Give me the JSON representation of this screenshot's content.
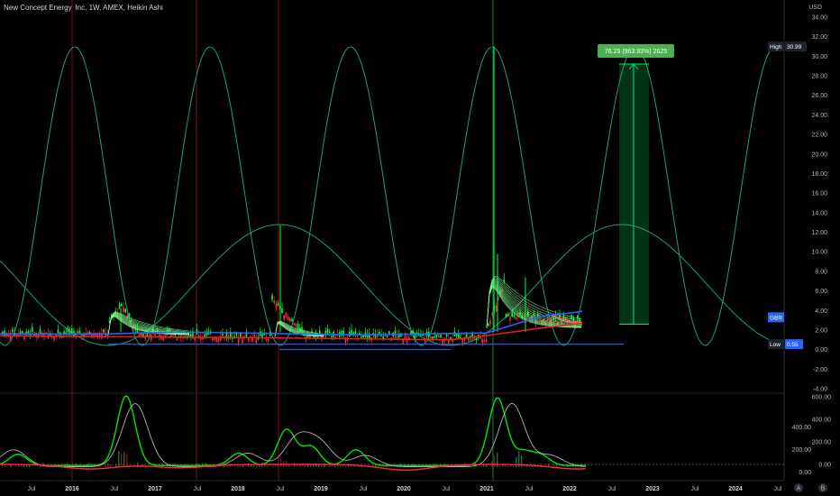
{
  "header": {
    "title": "New Concept Energy, Inc, 1W, AMEX, Heikin Ashi"
  },
  "currency": "USD",
  "badges": {
    "high_label": "High",
    "high_value": "30.99",
    "gbr": "GBR",
    "low_label": "Low",
    "low_value": "0.55"
  },
  "measure_label": "76.25 (963.93%) 2625",
  "footer_buttons": [
    "A",
    "B"
  ],
  "colors": {
    "background": "#000000",
    "bull": "#00ff3b",
    "bear": "#ff2b2b",
    "cycle": "#1f9e74",
    "ma_blue": "#2962ff",
    "ma_red": "#e91e1e",
    "measure": "#00e676"
  },
  "chart_data": [
    {
      "type": "candlestick",
      "ylim": [
        -4,
        34
      ],
      "yticks": [
        "34.00",
        "32.00",
        "30.00",
        "28.00",
        "26.00",
        "24.00",
        "22.00",
        "20.00",
        "18.00",
        "16.00",
        "14.00",
        "12.00",
        "10.00",
        "8.00",
        "6.00",
        "4.00",
        "2.00",
        "0.00",
        "-2.00",
        "-4.00"
      ],
      "xticks": [
        "Jul",
        "2016",
        "Jul",
        "2017",
        "Jul",
        "2018",
        "Jul",
        "2019",
        "Jul",
        "2020",
        "Jul",
        "2021",
        "Jul",
        "2022",
        "Jul",
        "2023",
        "Jul",
        "2024",
        "Jul"
      ],
      "price_spikes": [
        {
          "x": "2016 Jul",
          "high": 4.2
        },
        {
          "x": "2018 Jul",
          "high": 12.7
        },
        {
          "x": "2021 Jan",
          "high": 30.99
        },
        {
          "x": "2021 Jan",
          "high": 9.8
        },
        {
          "x": "2021 Jul",
          "high": 7.4
        }
      ],
      "support_lines": [
        0.55,
        0.0
      ],
      "measure": {
        "from": 2.6,
        "to": 29.2
      }
    },
    {
      "type": "line",
      "yticks": [
        "600.00",
        "400.00",
        "200.00",
        "0.00"
      ],
      "series": [
        {
          "values": []
        },
        {
          "values": []
        }
      ]
    }
  ]
}
